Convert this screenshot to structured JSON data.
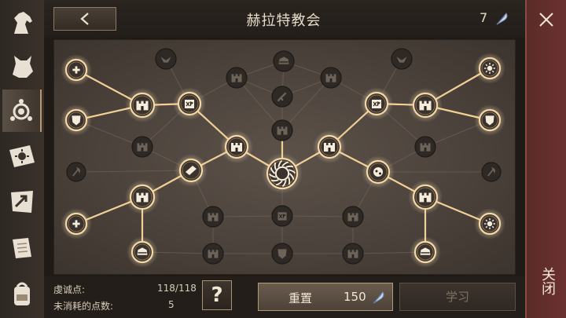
{
  "header": {
    "title": "赫拉特教会",
    "points_count": "7"
  },
  "sidebar": {
    "items": [
      {
        "icon": "horse-head-icon"
      },
      {
        "icon": "dog-head-icon"
      },
      {
        "icon": "faith-symbol-icon",
        "active": true
      },
      {
        "icon": "sun-scroll-icon"
      },
      {
        "icon": "map-arrow-icon"
      },
      {
        "icon": "scroll-quill-icon"
      },
      {
        "icon": "backpack-icon"
      }
    ]
  },
  "close_panel": {
    "close_label": "关闭"
  },
  "footer": {
    "devotion_label": "虔诚点:",
    "devotion_value": "118/118",
    "unspent_label": "未消耗的点数:",
    "unspent_value": "5",
    "help_label": "?",
    "reset_label": "重置",
    "reset_cost": "150",
    "learn_label": "学习"
  },
  "colors": {
    "active_glow": "#f0c890",
    "inactive_node": "#2f2925",
    "close_panel": "#6b3230",
    "board": "#4a413a"
  }
}
